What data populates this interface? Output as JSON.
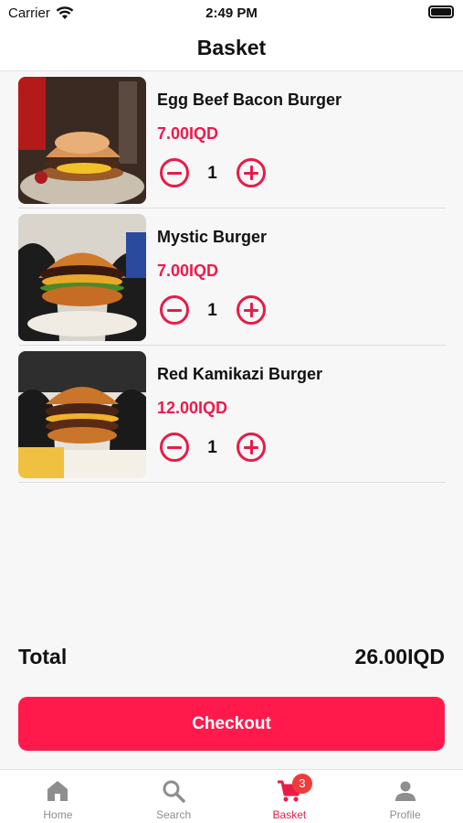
{
  "status_bar": {
    "carrier": "Carrier",
    "time": "2:49 PM"
  },
  "nav": {
    "title": "Basket"
  },
  "items": [
    {
      "name": "Egg Beef Bacon Burger",
      "price": "7.00IQD",
      "quantity": "1"
    },
    {
      "name": "Mystic Burger",
      "price": "7.00IQD",
      "quantity": "1"
    },
    {
      "name": "Red Kamikazi Burger",
      "price": "12.00IQD",
      "quantity": "1"
    }
  ],
  "total": {
    "label": "Total",
    "value": "26.00IQD"
  },
  "checkout": {
    "label": "Checkout"
  },
  "tabs": [
    {
      "label": "Home",
      "icon": "home-icon"
    },
    {
      "label": "Search",
      "icon": "search-icon"
    },
    {
      "label": "Basket",
      "icon": "cart-icon",
      "badge": "3",
      "active": true
    },
    {
      "label": "Profile",
      "icon": "profile-icon"
    }
  ],
  "colors": {
    "accent": "#ff1a4b",
    "price": "#f0194a",
    "badge": "#f03b3b"
  }
}
